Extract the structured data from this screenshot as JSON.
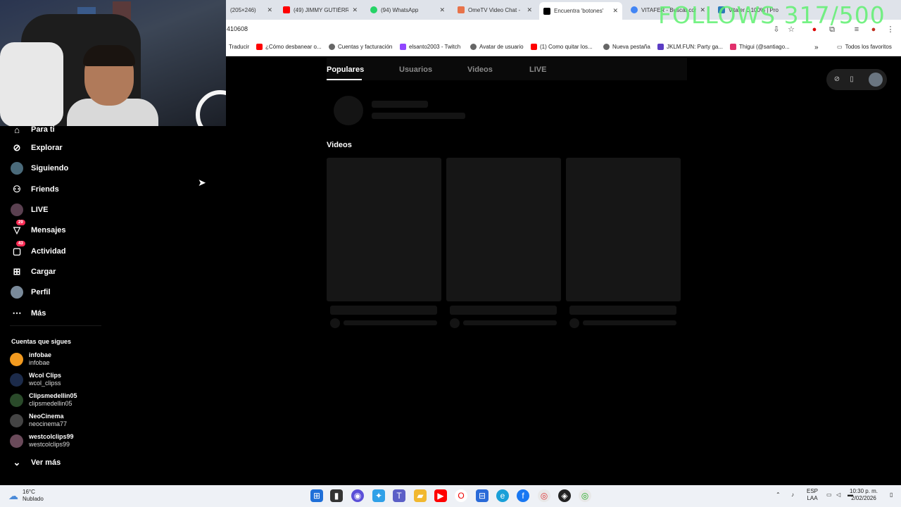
{
  "browser": {
    "tabs": [
      {
        "title": "(205×246)",
        "color": "#9aa0a6"
      },
      {
        "title": "(49) JIMMY GUTIÉRREZ",
        "color": "#ff0000"
      },
      {
        "title": "(94) WhatsApp",
        "color": "#25d366"
      },
      {
        "title": "OmeTV Video Chat -",
        "color": "#e8734a"
      },
      {
        "title": "Encuentra 'botones'",
        "color": "#000000"
      },
      {
        "title": "VITAFER - Buscar con",
        "color": "#4285f4"
      },
      {
        "title": "Vitafer L 100% | Pro",
        "color": "#2a7ab8"
      }
    ],
    "url": "410608",
    "bookmarks": [
      {
        "label": "Traducir",
        "color": "#4285f4"
      },
      {
        "label": "¿Cómo desbanear o...",
        "color": "#ff0000"
      },
      {
        "label": "Cuentas y facturación",
        "color": "#666666"
      },
      {
        "label": "elsanto2003 - Twitch",
        "color": "#9146ff"
      },
      {
        "label": "Avatar de usuario",
        "color": "#666666"
      },
      {
        "label": "(1) Como quitar los...",
        "color": "#ff0000"
      },
      {
        "label": "Nueva pestaña",
        "color": "#666666"
      },
      {
        "label": "JKLM.FUN: Party ga...",
        "color": "#5b3cc4"
      },
      {
        "label": "Thigui (@santiago...",
        "color": "#e1306c"
      },
      {
        "label": "Todos los favoritos",
        "color": "#666666"
      }
    ]
  },
  "overlay": {
    "follows": "FOLLOWS 317/500"
  },
  "sidebar": {
    "nav": [
      {
        "label": "Para ti",
        "icon": "home-icon"
      },
      {
        "label": "Explorar",
        "icon": "compass-icon"
      },
      {
        "label": "Siguiendo",
        "icon": "following-avatar-icon"
      },
      {
        "label": "Friends",
        "icon": "friends-icon"
      },
      {
        "label": "LIVE",
        "icon": "live-icon"
      },
      {
        "label": "Mensajes",
        "icon": "messages-icon",
        "badge": "29"
      },
      {
        "label": "Actividad",
        "icon": "activity-icon",
        "badge": "43"
      },
      {
        "label": "Cargar",
        "icon": "upload-icon"
      },
      {
        "label": "Perfil",
        "icon": "profile-avatar-icon"
      },
      {
        "label": "Más",
        "icon": "more-icon"
      }
    ],
    "following_title": "Cuentas que sigues",
    "accounts": [
      {
        "name": "infobae",
        "handle": "infobae",
        "color": "#f29a1f"
      },
      {
        "name": "Wcol Clips",
        "handle": "wcol_clipss",
        "color": "#1c2b4a"
      },
      {
        "name": "Clipsmedellin05",
        "handle": "clipsmedellin05",
        "color": "#2a4a2a"
      },
      {
        "name": "NeoCinema",
        "handle": "neocinema77",
        "color": "#444444"
      },
      {
        "name": "westcolclips99",
        "handle": "westcolclips99",
        "color": "#6a4a5a"
      }
    ],
    "see_more": "Ver más"
  },
  "main": {
    "tabs": [
      "Populares",
      "Usuarios",
      "Videos",
      "LIVE"
    ],
    "active_tab": "Populares",
    "videos_title": "Videos"
  },
  "taskbar": {
    "weather_temp": "16°C",
    "weather_desc": "Nublado",
    "lang": "ESP",
    "lang_sub": "LAA",
    "time": "10:30 p. m.",
    "date": "2/02/2026"
  }
}
